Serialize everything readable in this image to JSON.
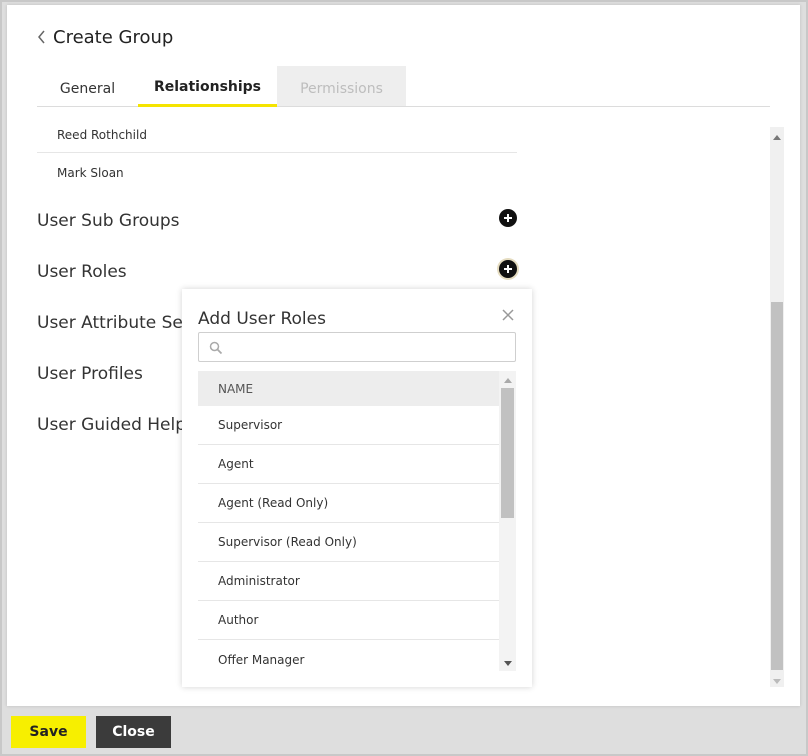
{
  "header": {
    "title": "Create Group"
  },
  "tabs": [
    {
      "label": "General",
      "state": "normal"
    },
    {
      "label": "Relationships",
      "state": "active"
    },
    {
      "label": "Permissions",
      "state": "disabled"
    }
  ],
  "members": [
    "Reed Rothchild",
    "Mark Sloan"
  ],
  "sections": {
    "user_sub_groups": "User Sub Groups",
    "user_roles": "User Roles",
    "user_attribute_sets": "User Attribute Se",
    "user_profiles": "User Profiles",
    "user_guided_help": "User Guided Help"
  },
  "popover": {
    "title": "Add User Roles",
    "search": {
      "value": "",
      "placeholder": ""
    },
    "column_header": "NAME",
    "roles": [
      "Supervisor",
      "Agent",
      "Agent (Read Only)",
      "Supervisor (Read Only)",
      "Administrator",
      "Author",
      "Offer Manager"
    ]
  },
  "footer": {
    "save_label": "Save",
    "close_label": "Close"
  },
  "colors": {
    "accent": "#f7ef00",
    "dark_button": "#3b3b3b",
    "tab_underline": "#f5e400"
  },
  "icons": {
    "back": "chevron-left-icon",
    "add": "plus-circle-icon",
    "close": "close-icon",
    "search": "search-icon"
  }
}
